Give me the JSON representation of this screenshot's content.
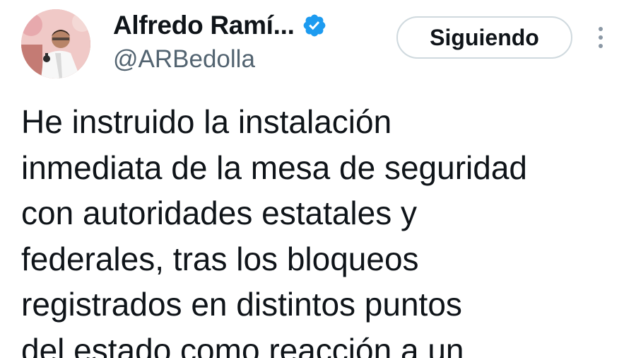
{
  "header": {
    "display_name": "Alfredo Ramí...",
    "handle": "@ARBedolla",
    "verified": true,
    "verified_icon": "verified-badge-icon",
    "follow_button_label": "Siguiendo",
    "more_icon": "more-vertical-icon"
  },
  "tweet": {
    "lines": [
      "He instruido la instalación",
      "inmediata de la mesa de seguridad",
      "con autoridades estatales y",
      "federales, tras los bloqueos",
      "registrados en distintos puntos",
      "del estado como reacción a un"
    ]
  },
  "colors": {
    "text": "#0f1419",
    "secondary": "#536471",
    "verified": "#1d9bf0",
    "button_border": "#cfd9de"
  }
}
